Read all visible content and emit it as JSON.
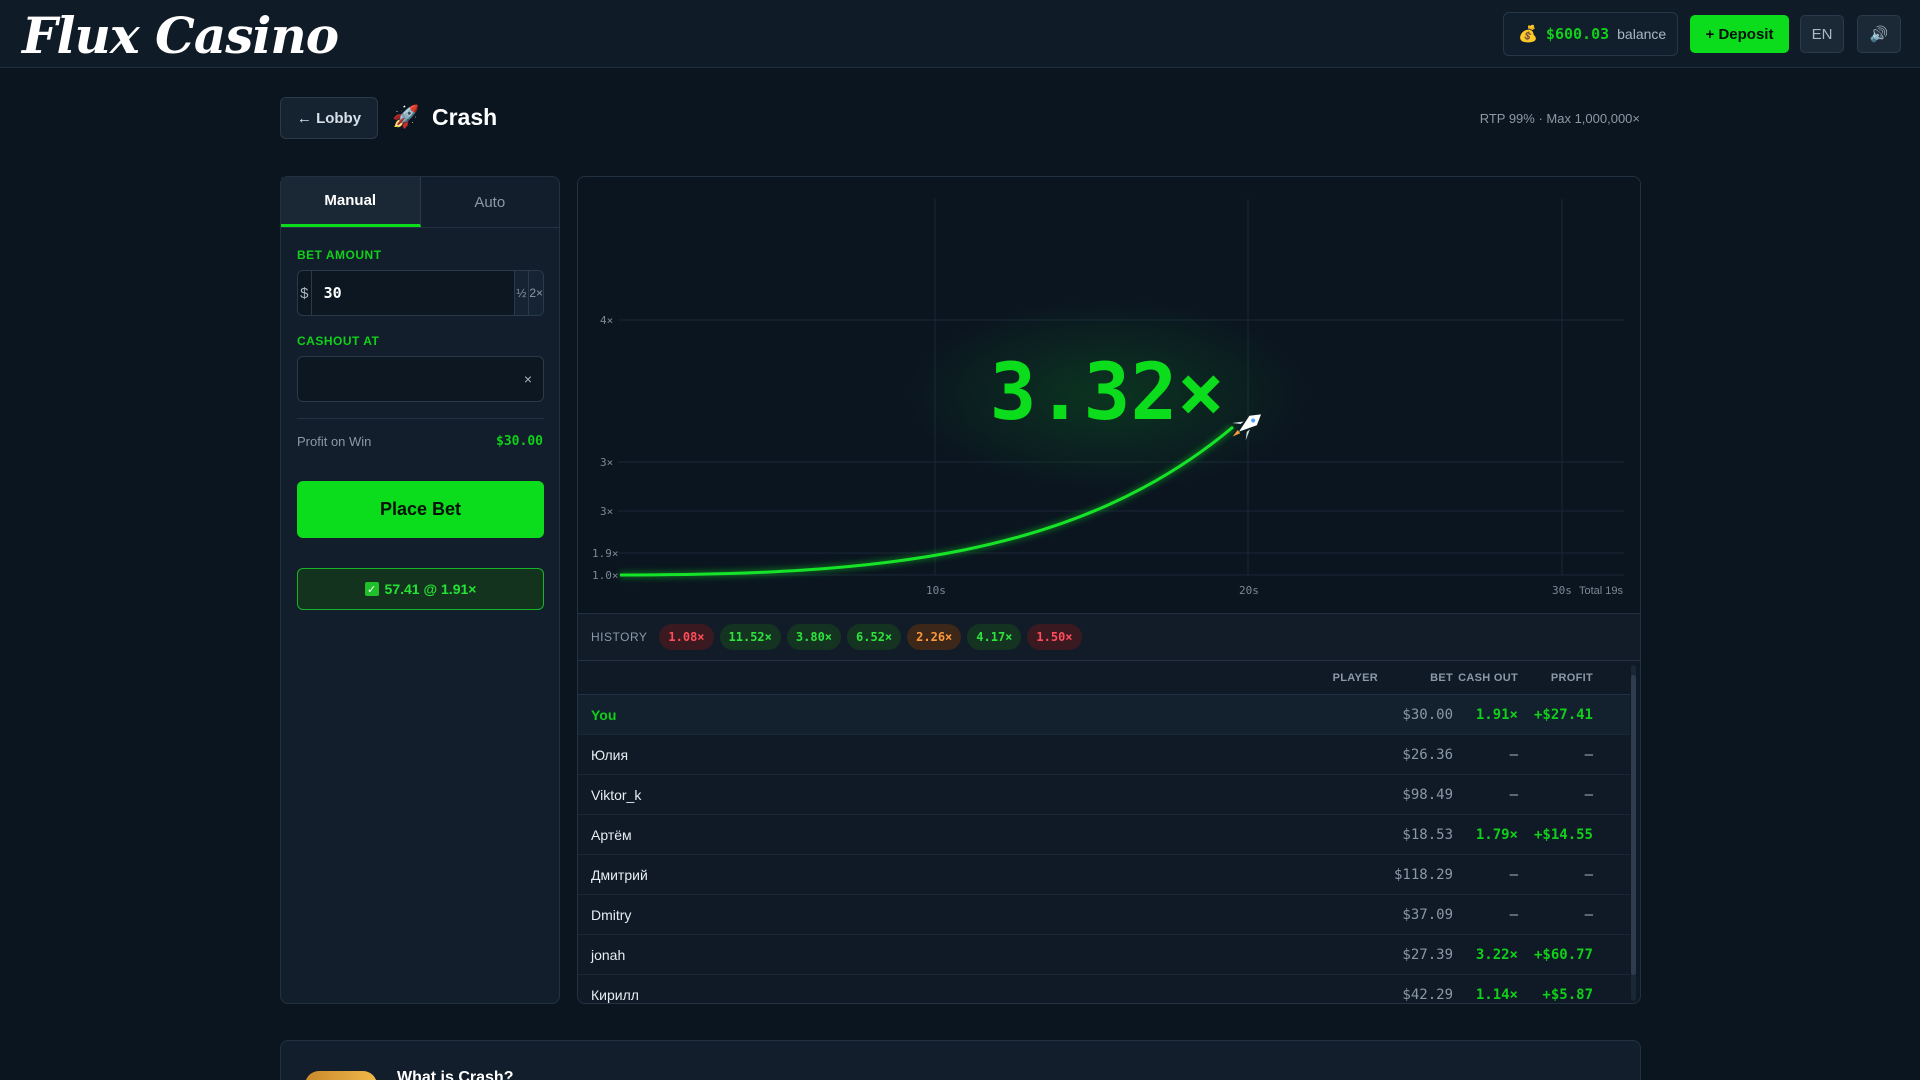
{
  "header": {
    "logo": "Flux Casino",
    "balance_amount": "$600.03",
    "balance_label": "balance",
    "deposit_label": "+ Deposit",
    "language": "EN",
    "sound_icon": "speaker-icon"
  },
  "title_row": {
    "lobby_label": "← Lobby",
    "game_icon": "🚀",
    "game_title": "Crash",
    "rtp": "RTP 99% · Max 1,000,000×"
  },
  "bet_panel": {
    "tabs": [
      "Manual",
      "Auto"
    ],
    "active_tab": "Manual",
    "bet_amount_label": "BET AMOUNT",
    "currency": "$",
    "bet_amount": "30",
    "half_label": "½",
    "double_label": "2×",
    "cashout_label": "CASHOUT AT",
    "cashout_value": "",
    "clear_label": "×",
    "profit_label": "Profit on Win",
    "profit_value": "$30.00",
    "place_bet_label": "Place Bet",
    "cashed_label": "57.41 @ 1.91×"
  },
  "chart": {
    "multiplier": "3.32×",
    "y_ticks": [
      "4×",
      "3×",
      "3×",
      "1.9×",
      "1.0×"
    ],
    "x_ticks": [
      "10s",
      "20s",
      "30s"
    ],
    "total_label": "Total 19s"
  },
  "history": {
    "label": "HISTORY",
    "chips": [
      {
        "value": "1.08×",
        "tone": "red"
      },
      {
        "value": "11.52×",
        "tone": "green"
      },
      {
        "value": "3.80×",
        "tone": "green"
      },
      {
        "value": "6.52×",
        "tone": "green"
      },
      {
        "value": "2.26×",
        "tone": "orange"
      },
      {
        "value": "4.17×",
        "tone": "green"
      },
      {
        "value": "1.50×",
        "tone": "red"
      }
    ]
  },
  "table": {
    "headers": {
      "player": "PLAYER",
      "bet": "BET",
      "cashout": "CASH OUT",
      "profit": "PROFIT"
    },
    "rows": [
      {
        "name": "You",
        "bet": "$30.00",
        "cashout": "1.91×",
        "profit": "+$27.41"
      },
      {
        "name": "Юлия",
        "bet": "$26.36",
        "cashout": "–",
        "profit": "–"
      },
      {
        "name": "Viktor_k",
        "bet": "$98.49",
        "cashout": "–",
        "profit": "–"
      },
      {
        "name": "Артём",
        "bet": "$18.53",
        "cashout": "1.79×",
        "profit": "+$14.55"
      },
      {
        "name": "Дмитрий",
        "bet": "$118.29",
        "cashout": "–",
        "profit": "–"
      },
      {
        "name": "Dmitry",
        "bet": "$37.09",
        "cashout": "–",
        "profit": "–"
      },
      {
        "name": "jonah",
        "bet": "$27.39",
        "cashout": "3.22×",
        "profit": "+$60.77"
      },
      {
        "name": "Кирилл",
        "bet": "$42.29",
        "cashout": "1.14×",
        "profit": "+$5.87"
      }
    ]
  },
  "about": {
    "title": "What is Crash?"
  }
}
